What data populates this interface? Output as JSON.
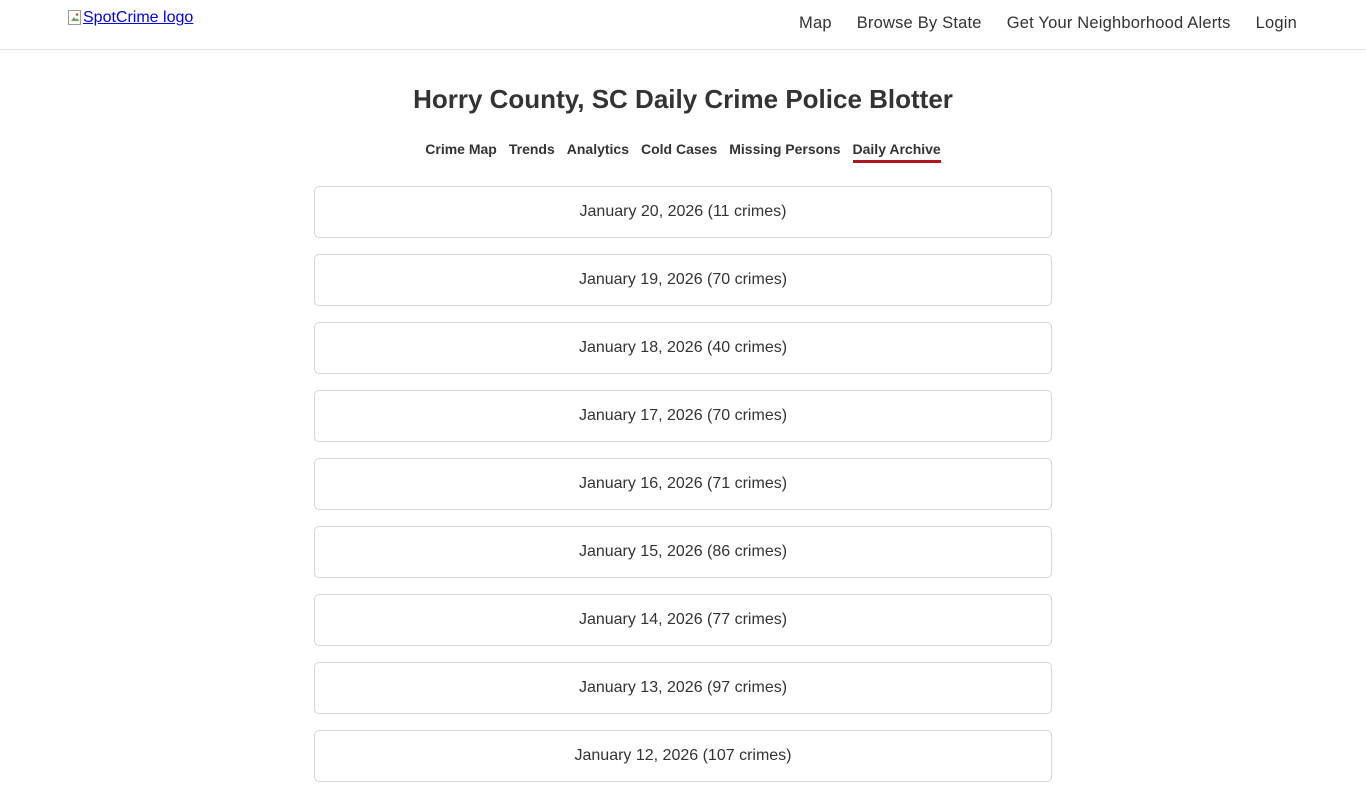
{
  "header": {
    "logo_alt": "SpotCrime logo",
    "nav": [
      {
        "label": "Map"
      },
      {
        "label": "Browse By State"
      },
      {
        "label": "Get Your Neighborhood Alerts"
      },
      {
        "label": "Login"
      }
    ]
  },
  "page": {
    "title": "Horry County, SC Daily Crime Police Blotter"
  },
  "tabs": [
    {
      "label": "Crime Map",
      "active": false
    },
    {
      "label": "Trends",
      "active": false
    },
    {
      "label": "Analytics",
      "active": false
    },
    {
      "label": "Cold Cases",
      "active": false
    },
    {
      "label": "Missing Persons",
      "active": false
    },
    {
      "label": "Daily Archive",
      "active": true
    }
  ],
  "archive": [
    {
      "label": "January 20, 2026 (11 crimes)"
    },
    {
      "label": "January 19, 2026 (70 crimes)"
    },
    {
      "label": "January 18, 2026 (40 crimes)"
    },
    {
      "label": "January 17, 2026 (70 crimes)"
    },
    {
      "label": "January 16, 2026 (71 crimes)"
    },
    {
      "label": "January 15, 2026 (86 crimes)"
    },
    {
      "label": "January 14, 2026 (77 crimes)"
    },
    {
      "label": "January 13, 2026 (97 crimes)"
    },
    {
      "label": "January 12, 2026 (107 crimes)"
    }
  ],
  "colors": {
    "active_underline": "#b0141e",
    "text": "#333333",
    "link": "#0000ee",
    "border": "#d6d6d6"
  }
}
